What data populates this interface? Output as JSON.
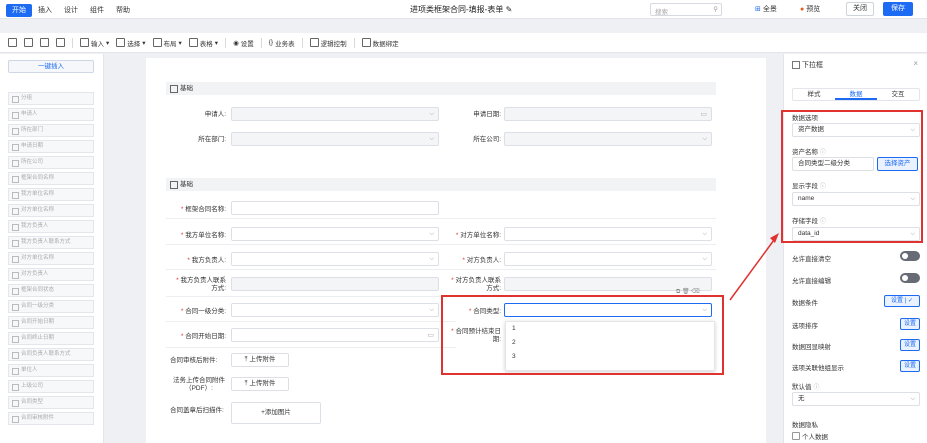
{
  "menu": {
    "items": [
      "开始",
      "插入",
      "设计",
      "组件",
      "帮助"
    ],
    "active": "开始"
  },
  "doc_title": "进项类框架合同-填报-表单",
  "search": {
    "placeholder": "搜索"
  },
  "header_actions": {
    "fullscreen": "全景",
    "preview": "预览",
    "close": "关闭",
    "save": "保存"
  },
  "toolbar": {
    "input": "输入",
    "select": "选择",
    "layout": "布局",
    "table": "表格",
    "settings": "设置",
    "business": "业务表",
    "logic": "逻辑控制",
    "data_bind": "数据绑定"
  },
  "left": {
    "insert_button": "一键插入",
    "items": [
      "分组",
      "申请人",
      "所在部门",
      "申请日期",
      "所在公司",
      "框架合同名称",
      "我方单位名称",
      "对方单位名称",
      "我方负责人",
      "我方负责人联系方式",
      "对方单位名称",
      "对方负责人",
      "框架合同状态",
      "合同一级分类",
      "合同开始日期",
      "合同终止日期",
      "合同负责人联系方式",
      "单位人",
      "上级公司",
      "合同类型",
      "合同审核附件"
    ]
  },
  "form": {
    "section1": "基础",
    "applicant": "申请人:",
    "apply_date": "申请日期:",
    "dept": "所在部门:",
    "company": "所在公司:",
    "section2": "基础",
    "contract_name": "框架合同名称:",
    "our_unit": "我方单位名称:",
    "other_unit": "对方单位名称:",
    "our_person": "我方负责人:",
    "other_person": "对方负责人:",
    "our_contact": "我方负责人联系方式:",
    "other_contact": "对方负责人联系方式:",
    "category1": "合同一级分类:",
    "contract_type": "合同类型:",
    "start_date": "合同开始日期:",
    "end_date": "合同预计结束日期:",
    "review_attach": "合同审核后附件:",
    "upload": "上传附件",
    "pdf_attach": "法务上传合同附件（PDF）:",
    "upload2": "上传附件",
    "seal_attach": "合同盖章后扫描件:",
    "add_image": "+添加图片"
  },
  "dropdown_options": [
    "1",
    "2",
    "3"
  ],
  "right": {
    "title": "下拉框",
    "tabs": [
      "样式",
      "数据",
      "交互"
    ],
    "active_tab": "数据",
    "data_source_label": "数据选项",
    "data_source_value": "资产数据",
    "asset_name_label": "资产名称",
    "asset_name_value": "合同类型二级分类",
    "pick_asset": "选择资产",
    "display_field_label": "显示字段",
    "display_field_value": "name",
    "store_field_label": "存储字段",
    "store_field_value": "data_id",
    "allow_clear": "允许直接清空",
    "allow_edit": "允许直接编辑",
    "data_condition": "数据条件",
    "data_condition_btn": "设置",
    "option_sort": "选项排序",
    "option_sort_btn": "设置",
    "data_mapping": "数据回显映射",
    "data_mapping_btn": "设置",
    "linked_display": "选项关联他组显示",
    "linked_display_btn": "设置",
    "default_label": "默认值",
    "default_value": "无",
    "privacy_label": "数据隐私",
    "privacy_option": "个人数据"
  },
  "colors": {
    "accent": "#1c6bf2",
    "highlight": "#e0322f"
  }
}
